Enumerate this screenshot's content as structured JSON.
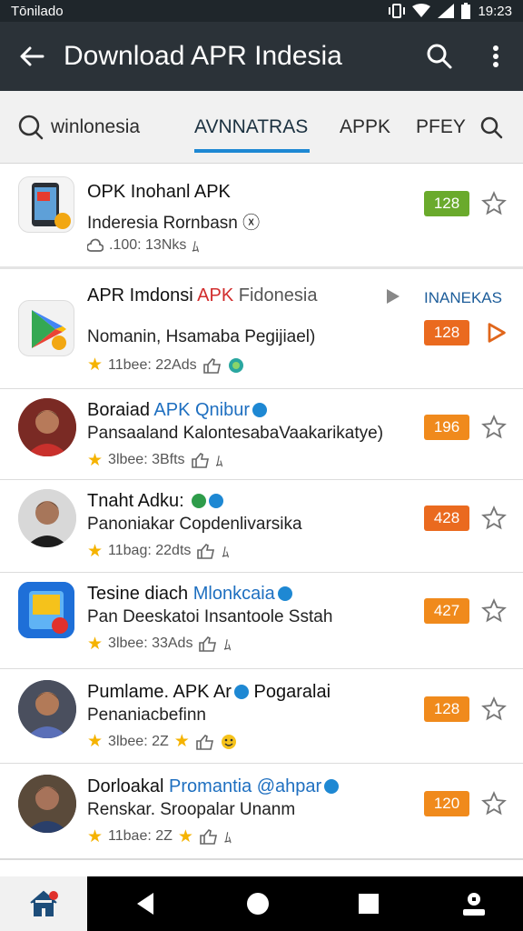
{
  "status": {
    "left": "Tōnilado",
    "time": "19:23"
  },
  "app_bar": {
    "title": "Download APR Indesia"
  },
  "tabs": [
    {
      "label": "winlonesia"
    },
    {
      "label": "AVNNATRAS"
    },
    {
      "label": "APPK"
    },
    {
      "label": "PFEY"
    }
  ],
  "items": [
    {
      "name": "OPK Inohanl APK",
      "sub": "Inderesia Rornbasn ⓧ",
      "meta": ".100: 13Nks",
      "meta_tail": "ﾑ",
      "badge": "128"
    },
    {
      "name_a": "APR Imdonsi",
      "name_b": "APK",
      "name_c": "Fidonesia",
      "side_label": "INANEKAS",
      "sub": "Nomanin, Hsamaba Pegijiael)",
      "meta": "11bee: 22Ads",
      "badge": "128"
    },
    {
      "name_a": "Boraiad",
      "name_b": "APK Qnibur",
      "sub": "Pansaaland KalontesabaVaakarikatye)",
      "meta": "3lbee: 3Bfts",
      "meta_tail": "ﾑ",
      "badge": "196"
    },
    {
      "name_a": "Tnaht Adku:",
      "sub": "Panoniakar Copdenlivarsika",
      "meta": "11bag: 22dts",
      "meta_tail": "ﾑ",
      "badge": "428"
    },
    {
      "name_a": "Tesine diach",
      "name_b": "Mlonkcaia",
      "sub": "Pan Deeskatoi Insantoole Sstah",
      "meta": "3lbee: 33Ads",
      "meta_tail": "ﾑ",
      "badge": "427"
    },
    {
      "name_a": "Pumlame. APK Ar",
      "name_c": "Pogaralai",
      "sub": "Penaniacbefinn",
      "meta": "3lbee: 2Z",
      "badge": "128"
    },
    {
      "name_a": "Dorloakal",
      "name_b": "Promantia @ahpar",
      "sub": "Renskar. Sroopalar Unanm",
      "meta": "11bae: 2Z",
      "meta_tail": "ﾑ",
      "badge": "120"
    }
  ],
  "colors": {
    "accent": "#1e88d3",
    "badge_orange": "#f08a1c",
    "badge_green": "#6aaa2c",
    "app_bar": "#2b3238"
  }
}
